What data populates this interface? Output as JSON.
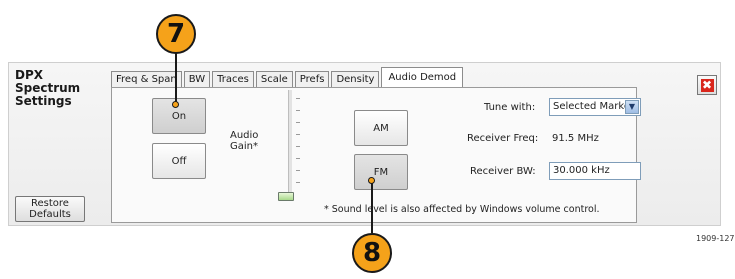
{
  "panel": {
    "title": "DPX Spectrum\nSettings",
    "restore_label": "Restore\nDefaults",
    "close_glyph": "✖"
  },
  "tabs": [
    {
      "label": "Freq & Span",
      "active": false
    },
    {
      "label": "BW",
      "active": false
    },
    {
      "label": "Traces",
      "active": false
    },
    {
      "label": "Scale",
      "active": false
    },
    {
      "label": "Prefs",
      "active": false
    },
    {
      "label": "Density",
      "active": false
    },
    {
      "label": "Audio Demod",
      "active": true
    }
  ],
  "audio": {
    "on_label": "On",
    "off_label": "Off",
    "gain_label": "Audio\nGain*",
    "am_label": "AM",
    "fm_label": "FM",
    "tune_label": "Tune with:",
    "tune_value": "Selected Marker",
    "receiver_freq_label": "Receiver Freq:",
    "receiver_freq_value": "91.5 MHz",
    "receiver_bw_label": "Receiver BW:",
    "receiver_bw_value": "30.000 kHz",
    "footnote": "* Sound level is also affected by Windows volume control."
  },
  "callouts": {
    "first": "7",
    "second": "8"
  },
  "figure_ref": "1909-127"
}
